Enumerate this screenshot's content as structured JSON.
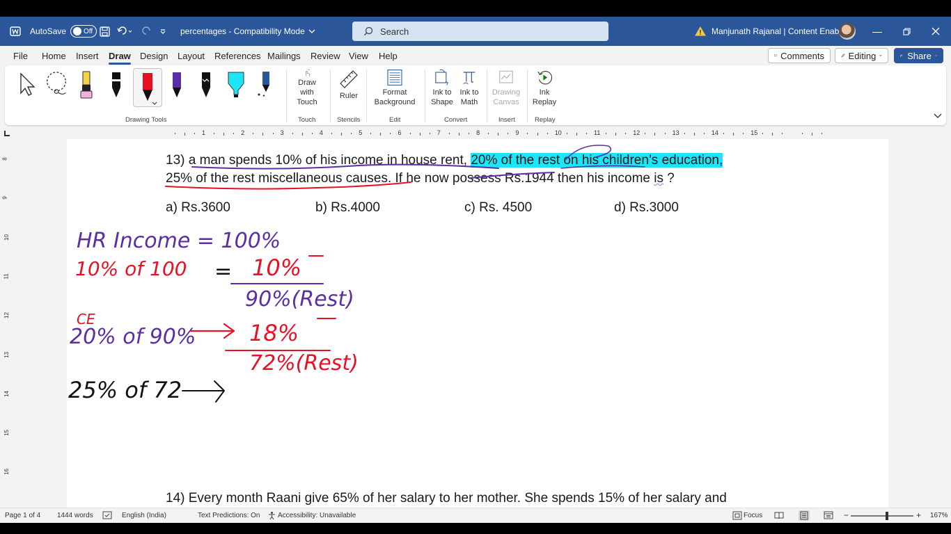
{
  "titlebar": {
    "autosave_label": "AutoSave",
    "autosave_state": "Off",
    "doc_title": "percentages  -  Compatibility Mode",
    "search_placeholder": "Search",
    "user": "Manjunath Rajanal | Content Enablers"
  },
  "menu": {
    "tabs": [
      "File",
      "Home",
      "Insert",
      "Draw",
      "Design",
      "Layout",
      "References",
      "Mailings",
      "Review",
      "View",
      "Help"
    ],
    "active": "Draw",
    "comments": "Comments",
    "editing": "Editing",
    "share": "Share"
  },
  "ribbon": {
    "draw_with_touch_1": "Draw with",
    "draw_with_touch_2": "Touch",
    "ruler": "Ruler",
    "format_bg_1": "Format",
    "format_bg_2": "Background",
    "ink_to_shape_1": "Ink to",
    "ink_to_shape_2": "Shape",
    "ink_to_math_1": "Ink to",
    "ink_to_math_2": "Math",
    "drawing_canvas_1": "Drawing",
    "drawing_canvas_2": "Canvas",
    "ink_replay_1": "Ink",
    "ink_replay_2": "Replay",
    "groups": {
      "drawing_tools": "Drawing Tools",
      "touch": "Touch",
      "stencils": "Stencils",
      "edit": "Edit",
      "convert": "Convert",
      "insert": "Insert",
      "replay": "Replay"
    },
    "pens": [
      {
        "name": "highlighter",
        "color": "#f6d24a"
      },
      {
        "name": "black-pen",
        "color": "#111111"
      },
      {
        "name": "red-pen",
        "color": "#e81123"
      },
      {
        "name": "purple-pen",
        "color": "#5b2ea6"
      },
      {
        "name": "black-pen-2",
        "color": "#111111"
      },
      {
        "name": "cyan-highlighter",
        "color": "#1ee4f7"
      },
      {
        "name": "galaxy-pen",
        "color": "#2b579a"
      }
    ]
  },
  "ruler": {
    "h_numbers": [
      "1",
      "2",
      "3",
      "4",
      "5",
      "6",
      "7",
      "8",
      "9",
      "10",
      "11",
      "12",
      "13",
      "14",
      "15"
    ],
    "v_numbers": [
      "8",
      "9",
      "10",
      "11",
      "12",
      "13",
      "14",
      "15",
      "16"
    ]
  },
  "document": {
    "q13_num": "13)",
    "q13_a": "a man spends 10% of his income in house rent,",
    "q13_hl": "20% of the rest on his children’s education,",
    "q13_b1": "25% of the rest miscellaneous causes",
    "q13_b2": ". If he now possess Rs.1944 then his income",
    "q13_is": "is",
    "q13_q": "?",
    "opt_a": "a) Rs.3600",
    "opt_b": "b) Rs.4000",
    "opt_c": "c) Rs. 4500",
    "opt_d": "d) Rs.3000",
    "q14": "14) Every month Raani give 65% of her salary to her mother. She spends 15% of her salary and",
    "q14_give": "give"
  },
  "ink": {
    "line1_purple": "HR  Income = 100%",
    "line2_red": "10% of 100",
    "eq": "=",
    "val_10": "10%",
    "rest_90": "90%(Rest)",
    "ce": "CE",
    "line3": "20% of 90%",
    "val_18": "18%",
    "rest_72": "72%(Rest)",
    "line4": "25% of 72"
  },
  "status": {
    "page": "Page 1 of 4",
    "words": "1444 words",
    "language": "English (India)",
    "predictions": "Text Predictions: On",
    "accessibility": "Accessibility: Unavailable",
    "focus": "Focus",
    "zoom": "167%"
  }
}
